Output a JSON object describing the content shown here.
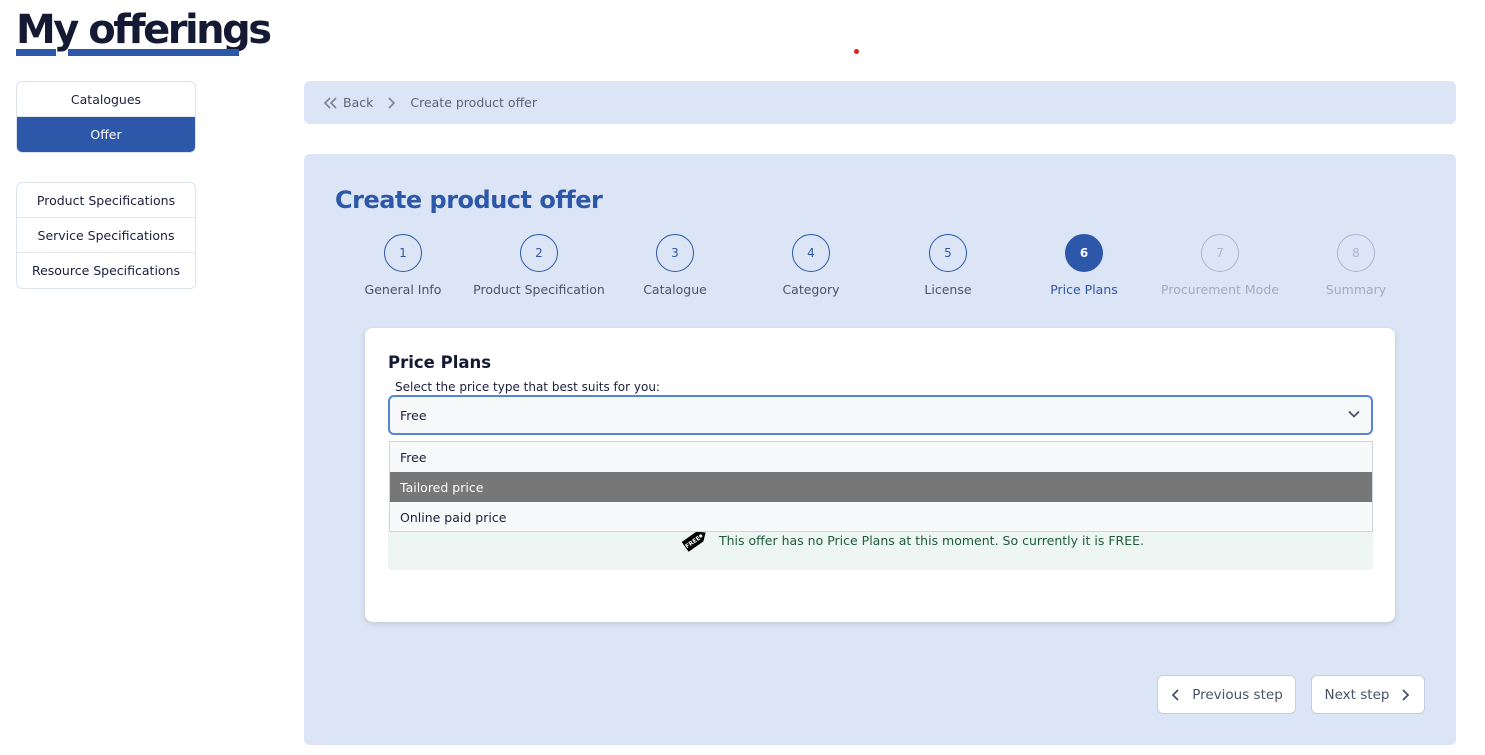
{
  "header": {
    "title": "My offerings"
  },
  "sidebar": {
    "group1": [
      {
        "label": "Catalogues",
        "active": false
      },
      {
        "label": "Offer",
        "active": true
      }
    ],
    "group2": [
      {
        "label": "Product Specifications"
      },
      {
        "label": "Service Specifications"
      },
      {
        "label": "Resource Specifications"
      }
    ]
  },
  "breadcrumb": {
    "back_label": "Back",
    "current": "Create product offer"
  },
  "main": {
    "title": "Create product offer",
    "steps": [
      {
        "num": "1",
        "label": "General Info",
        "state": "done"
      },
      {
        "num": "2",
        "label": "Product Specification",
        "state": "done"
      },
      {
        "num": "3",
        "label": "Catalogue",
        "state": "done"
      },
      {
        "num": "4",
        "label": "Category",
        "state": "done"
      },
      {
        "num": "5",
        "label": "License",
        "state": "done"
      },
      {
        "num": "6",
        "label": "Price Plans",
        "state": "current"
      },
      {
        "num": "7",
        "label": "Procurement Mode",
        "state": "disabled"
      },
      {
        "num": "8",
        "label": "Summary",
        "state": "disabled"
      }
    ],
    "card": {
      "title": "Price Plans",
      "select_label": "Select the price type that best suits for you:",
      "select_value": "Free",
      "options": [
        "Free",
        "Tailored price",
        "Online paid price"
      ],
      "hovered_option": "Tailored price",
      "info_text": "This offer has no Price Plans at this moment. So currently it is FREE.",
      "tag_text": "FREE"
    },
    "buttons": {
      "previous": "Previous step",
      "next": "Next step"
    }
  },
  "colors": {
    "accent": "#2d57a8",
    "panel": "#dce5f5",
    "info": "#1e5c3a"
  }
}
